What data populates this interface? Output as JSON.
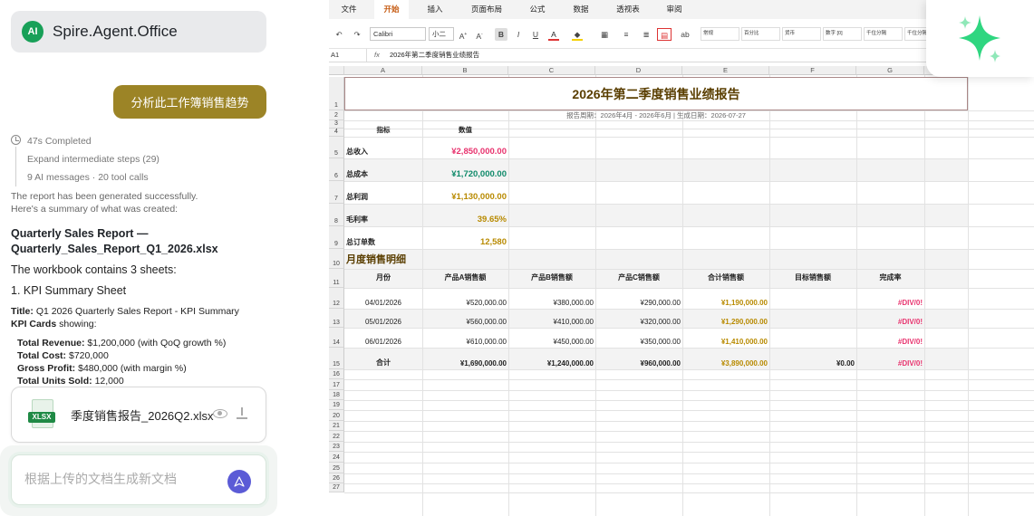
{
  "app": {
    "logo_text": "AI",
    "title": "Spire.Agent.Office"
  },
  "chat": {
    "user_prompt": "分析此工作簿销售趋势",
    "steps": {
      "completed": "47s Completed",
      "expand": "Expand intermediate steps (29)",
      "meta": "9 AI messages · 20 tool calls"
    },
    "response_intro_1": "The report has been generated successfully.",
    "response_intro_2": "Here's a summary of what was created:",
    "report_title": "Quarterly Sales Report — Quarterly_Sales_Report_Q1_2026.xlsx",
    "sheets_line": "The workbook contains 3 sheets:",
    "sheet1": "1. KPI Summary Sheet",
    "title_label": "Title:",
    "title_value": "Q1 2026 Quarterly Sales Report - KPI Summary",
    "kpi_label": "KPI Cards",
    "kpi_suffix": "showing:",
    "kpis": [
      {
        "label": "Total Revenue:",
        "value": "$1,200,000 (with QoQ growth %)"
      },
      {
        "label": "Total Cost:",
        "value": "$720,000"
      },
      {
        "label": "Gross Profit:",
        "value": "$480,000 (with margin %)"
      },
      {
        "label": "Total Units Sold:",
        "value": "12,000"
      }
    ],
    "file": {
      "icon_label": "XLSX",
      "name": "季度销售报告_2026Q2.xlsx"
    },
    "input_placeholder": "根据上传的文档生成新文档"
  },
  "sheet": {
    "tabs": [
      "文件",
      "开始",
      "插入",
      "页面布局",
      "公式",
      "数据",
      "透视表",
      "审阅"
    ],
    "active_tab": "开始",
    "font_name": "Calibri",
    "font_size": "小二",
    "style_boxes": [
      "常规",
      "百分比",
      "货币",
      "数字 [0]",
      "千位分隔",
      "千位分隔"
    ],
    "name_box": "A1",
    "fx": "fx",
    "formula": "2026年第二季度销售业绩报告",
    "columns": [
      "A",
      "B",
      "C",
      "D",
      "E",
      "F",
      "G"
    ],
    "rows": [
      "1",
      "2",
      "3",
      "4",
      "5",
      "6",
      "7",
      "8",
      "9",
      "10",
      "11",
      "12",
      "13",
      "14",
      "15",
      "16",
      "17",
      "18",
      "19",
      "20",
      "21",
      "22",
      "23",
      "24",
      "25",
      "26",
      "27"
    ],
    "title": "2026年第二季度销售业绩报告",
    "subtitle": "报告周期：2026年4月 - 2026年6月 | 生成日期：2026-07-27",
    "kpi_header": {
      "metric": "指标",
      "value": "数值"
    },
    "kpi_rows": [
      {
        "label": "总收入",
        "value": "¥2,850,000.00",
        "color": "#e8336e"
      },
      {
        "label": "总成本",
        "value": "¥1,720,000.00",
        "color": "#0f8a6a"
      },
      {
        "label": "总利润",
        "value": "¥1,130,000.00",
        "color": "#b88a00"
      },
      {
        "label": "毛利率",
        "value": "39.65%",
        "color": "#b88a00"
      },
      {
        "label": "总订单数",
        "value": "12,580",
        "color": "#b88a00"
      }
    ],
    "section_title": "月度销售明细",
    "table_headers": [
      "月份",
      "产品A销售额",
      "产品B销售额",
      "产品C销售额",
      "合计销售额",
      "目标销售额",
      "完成率"
    ],
    "table_rows": [
      [
        "04/01/2026",
        "¥520,000.00",
        "¥380,000.00",
        "¥290,000.00",
        "¥1,190,000.00",
        "",
        "#DIV/0!"
      ],
      [
        "05/01/2026",
        "¥560,000.00",
        "¥410,000.00",
        "¥320,000.00",
        "¥1,290,000.00",
        "",
        "#DIV/0!"
      ],
      [
        "06/01/2026",
        "¥610,000.00",
        "¥450,000.00",
        "¥350,000.00",
        "¥1,410,000.00",
        "",
        "#DIV/0!"
      ]
    ],
    "total_row": [
      "合计",
      "¥1,690,000.00",
      "¥1,240,000.00",
      "¥960,000.00",
      "¥3,890,000.00",
      "¥0.00",
      "#DIV/0!"
    ],
    "colors": {
      "total_sales": "#b88a00",
      "error": "#e8336e",
      "title": "#5a3e00",
      "accent_tab": "#c55a11"
    }
  }
}
